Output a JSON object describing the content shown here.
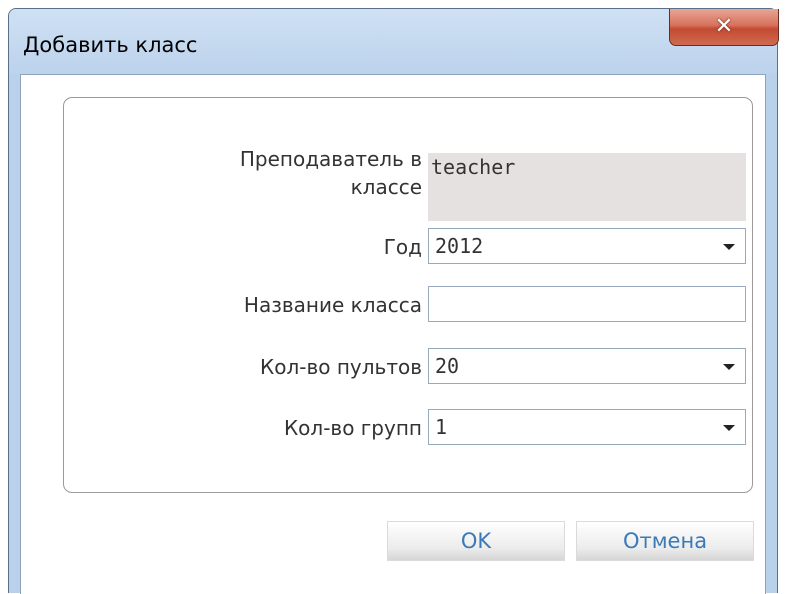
{
  "window": {
    "title": "Добавить класс",
    "close_glyph": "✕"
  },
  "form": {
    "teacher_label_line1": "Преподаватель в",
    "teacher_label_line2": "классе",
    "teacher_value": "teacher",
    "year_label": "Год",
    "year_value": "2012",
    "class_name_label": "Название класса",
    "class_name_value": "",
    "remotes_label": "Кол-во пультов",
    "remotes_value": "20",
    "groups_label": "Кол-во групп",
    "groups_value": "1"
  },
  "buttons": {
    "ok_label": "OK",
    "cancel_label": "Отмена"
  },
  "icons": {
    "close": "close-icon",
    "dropdown": "chevron-down-icon"
  }
}
